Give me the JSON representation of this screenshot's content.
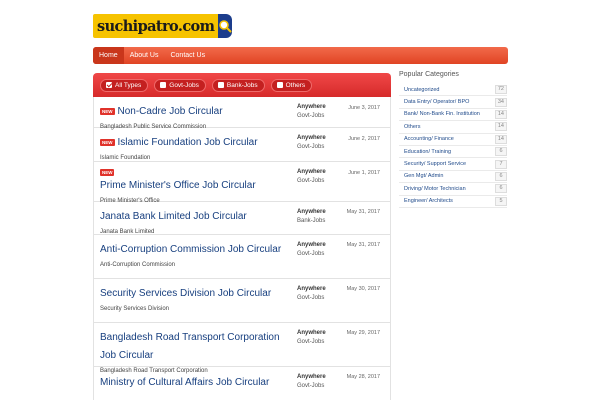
{
  "logo": {
    "text": "suchipatro.com"
  },
  "nav": {
    "items": [
      {
        "label": "Home",
        "active": true
      },
      {
        "label": "About Us",
        "active": false
      },
      {
        "label": "Contact Us",
        "active": false
      }
    ]
  },
  "filters": {
    "items": [
      {
        "label": "All Types",
        "active": true
      },
      {
        "label": "Govt-Jobs",
        "active": false
      },
      {
        "label": "Bank-Jobs",
        "active": false
      },
      {
        "label": "Others",
        "active": false
      }
    ]
  },
  "jobs": [
    {
      "new": true,
      "title": "Non-Cadre Job Circular",
      "company": "Bangladesh Public Service Commission",
      "location": "Anywhere",
      "category": "Govt-Jobs",
      "date": "June 3, 2017"
    },
    {
      "new": true,
      "title": "Islamic Foundation Job Circular",
      "company": "Islamic Foundation",
      "location": "Anywhere",
      "category": "Govt-Jobs",
      "date": "June 2, 2017"
    },
    {
      "new": true,
      "title": "Prime Minister's Office Job Circular",
      "company": "Prime Minister's Office",
      "location": "Anywhere",
      "category": "Govt-Jobs",
      "date": "June 1, 2017"
    },
    {
      "new": false,
      "title": "Janata Bank Limited Job Circular",
      "company": "Janata Bank Limited",
      "location": "Anywhere",
      "category": "Bank-Jobs",
      "date": "May 31, 2017"
    },
    {
      "new": false,
      "title": "Anti-Corruption Commission Job Circular",
      "company": "Anti-Corruption Commission",
      "location": "Anywhere",
      "category": "Govt-Jobs",
      "date": "May 31, 2017"
    },
    {
      "new": false,
      "title": "Security Services Division Job Circular",
      "company": "Security Services Division",
      "location": "Anywhere",
      "category": "Govt-Jobs",
      "date": "May 30, 2017"
    },
    {
      "new": false,
      "title": "Bangladesh Road Transport Corporation Job Circular",
      "company": "Bangladesh Road Transport Corporation",
      "location": "Anywhere",
      "category": "Govt-Jobs",
      "date": "May 29, 2017"
    },
    {
      "new": false,
      "title": "Ministry of Cultural Affairs Job Circular",
      "company": "",
      "location": "Anywhere",
      "category": "Govt-Jobs",
      "date": "May 28, 2017"
    }
  ],
  "sidebar": {
    "title": "Popular Categories",
    "categories": [
      {
        "name": "Uncategorized",
        "count": "72"
      },
      {
        "name": "Data Entry/ Operator/ BPO",
        "count": "34"
      },
      {
        "name": "Bank/ Non-Bank Fin. Institution",
        "count": "14"
      },
      {
        "name": "Others",
        "count": "14"
      },
      {
        "name": "Accounting/ Finance",
        "count": "14"
      },
      {
        "name": "Education/ Training",
        "count": "6"
      },
      {
        "name": "Security/ Support Service",
        "count": "7"
      },
      {
        "name": "Gen Mgt/ Admin",
        "count": "6"
      },
      {
        "name": "Driving/ Motor Technician",
        "count": "6"
      },
      {
        "name": "Engineer/ Architects",
        "count": "5"
      }
    ]
  },
  "colors": {
    "nav": "#e04424",
    "filter_bar": "#d62a2a",
    "link": "#173f7f",
    "logo_bg": "#f6c300",
    "logo_badge": "#1c3d8c"
  }
}
